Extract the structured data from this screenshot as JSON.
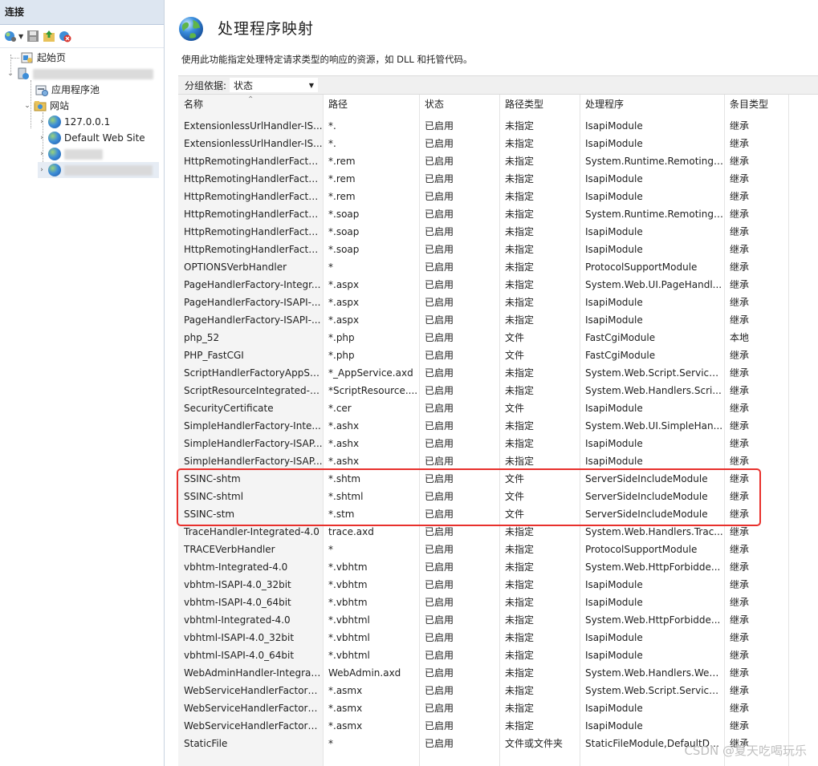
{
  "connections": {
    "title": "连接",
    "toolbar": [
      "connect-icon",
      "save-icon",
      "up-icon",
      "disconnect-icon"
    ],
    "tree": [
      {
        "label": "起始页",
        "icon": "start-page-icon"
      },
      {
        "label": "",
        "icon": "server-icon"
      },
      {
        "label": "应用程序池",
        "icon": "app-pool-icon"
      },
      {
        "label": "网站",
        "icon": "sites-folder-icon"
      },
      {
        "label": "127.0.0.1",
        "icon": "globe-icon"
      },
      {
        "label": "Default Web Site",
        "icon": "globe-icon"
      },
      {
        "label": "",
        "icon": "globe-icon"
      },
      {
        "label": "",
        "icon": "globe-icon"
      }
    ]
  },
  "page": {
    "title": "处理程序映射",
    "description": "使用此功能指定处理特定请求类型的响应的资源，如 DLL 和托管代码。",
    "groupby_label": "分组依据:",
    "groupby_value": "状态"
  },
  "table": {
    "columns": [
      "名称",
      "路径",
      "状态",
      "路径类型",
      "处理程序",
      "条目类型"
    ],
    "rows": [
      [
        "ExtensionlessUrlHandler-IS...",
        "*.",
        "已启用",
        "未指定",
        "IsapiModule",
        "继承"
      ],
      [
        "ExtensionlessUrlHandler-IS...",
        "*.",
        "已启用",
        "未指定",
        "IsapiModule",
        "继承"
      ],
      [
        "HttpRemotingHandlerFacto...",
        "*.rem",
        "已启用",
        "未指定",
        "System.Runtime.Remoting....",
        "继承"
      ],
      [
        "HttpRemotingHandlerFacto...",
        "*.rem",
        "已启用",
        "未指定",
        "IsapiModule",
        "继承"
      ],
      [
        "HttpRemotingHandlerFacto...",
        "*.rem",
        "已启用",
        "未指定",
        "IsapiModule",
        "继承"
      ],
      [
        "HttpRemotingHandlerFacto...",
        "*.soap",
        "已启用",
        "未指定",
        "System.Runtime.Remoting....",
        "继承"
      ],
      [
        "HttpRemotingHandlerFacto...",
        "*.soap",
        "已启用",
        "未指定",
        "IsapiModule",
        "继承"
      ],
      [
        "HttpRemotingHandlerFacto...",
        "*.soap",
        "已启用",
        "未指定",
        "IsapiModule",
        "继承"
      ],
      [
        "OPTIONSVerbHandler",
        "*",
        "已启用",
        "未指定",
        "ProtocolSupportModule",
        "继承"
      ],
      [
        "PageHandlerFactory-Integr...",
        "*.aspx",
        "已启用",
        "未指定",
        "System.Web.UI.PageHandl...",
        "继承"
      ],
      [
        "PageHandlerFactory-ISAPI-...",
        "*.aspx",
        "已启用",
        "未指定",
        "IsapiModule",
        "继承"
      ],
      [
        "PageHandlerFactory-ISAPI-...",
        "*.aspx",
        "已启用",
        "未指定",
        "IsapiModule",
        "继承"
      ],
      [
        "php_52",
        "*.php",
        "已启用",
        "文件",
        "FastCgiModule",
        "本地"
      ],
      [
        "PHP_FastCGI",
        "*.php",
        "已启用",
        "文件",
        "FastCgiModule",
        "继承"
      ],
      [
        "ScriptHandlerFactoryAppSe...",
        "*_AppService.axd",
        "已启用",
        "未指定",
        "System.Web.Script.Services....",
        "继承"
      ],
      [
        "ScriptResourceIntegrated-4.0",
        "*ScriptResource....",
        "已启用",
        "未指定",
        "System.Web.Handlers.Scri...",
        "继承"
      ],
      [
        "SecurityCertificate",
        "*.cer",
        "已启用",
        "文件",
        "IsapiModule",
        "继承"
      ],
      [
        "SimpleHandlerFactory-Inte...",
        "*.ashx",
        "已启用",
        "未指定",
        "System.Web.UI.SimpleHan...",
        "继承"
      ],
      [
        "SimpleHandlerFactory-ISAP...",
        "*.ashx",
        "已启用",
        "未指定",
        "IsapiModule",
        "继承"
      ],
      [
        "SimpleHandlerFactory-ISAP...",
        "*.ashx",
        "已启用",
        "未指定",
        "IsapiModule",
        "继承"
      ],
      [
        "SSINC-shtm",
        "*.shtm",
        "已启用",
        "文件",
        "ServerSideIncludeModule",
        "继承"
      ],
      [
        "SSINC-shtml",
        "*.shtml",
        "已启用",
        "文件",
        "ServerSideIncludeModule",
        "继承"
      ],
      [
        "SSINC-stm",
        "*.stm",
        "已启用",
        "文件",
        "ServerSideIncludeModule",
        "继承"
      ],
      [
        "TraceHandler-Integrated-4.0",
        "trace.axd",
        "已启用",
        "未指定",
        "System.Web.Handlers.Trac...",
        "继承"
      ],
      [
        "TRACEVerbHandler",
        "*",
        "已启用",
        "未指定",
        "ProtocolSupportModule",
        "继承"
      ],
      [
        "vbhtm-Integrated-4.0",
        "*.vbhtm",
        "已启用",
        "未指定",
        "System.Web.HttpForbidde...",
        "继承"
      ],
      [
        "vbhtm-ISAPI-4.0_32bit",
        "*.vbhtm",
        "已启用",
        "未指定",
        "IsapiModule",
        "继承"
      ],
      [
        "vbhtm-ISAPI-4.0_64bit",
        "*.vbhtm",
        "已启用",
        "未指定",
        "IsapiModule",
        "继承"
      ],
      [
        "vbhtml-Integrated-4.0",
        "*.vbhtml",
        "已启用",
        "未指定",
        "System.Web.HttpForbidde...",
        "继承"
      ],
      [
        "vbhtml-ISAPI-4.0_32bit",
        "*.vbhtml",
        "已启用",
        "未指定",
        "IsapiModule",
        "继承"
      ],
      [
        "vbhtml-ISAPI-4.0_64bit",
        "*.vbhtml",
        "已启用",
        "未指定",
        "IsapiModule",
        "继承"
      ],
      [
        "WebAdminHandler-Integrat...",
        "WebAdmin.axd",
        "已启用",
        "未指定",
        "System.Web.Handlers.Web...",
        "继承"
      ],
      [
        "WebServiceHandlerFactory-...",
        "*.asmx",
        "已启用",
        "未指定",
        "System.Web.Script.Services....",
        "继承"
      ],
      [
        "WebServiceHandlerFactory-...",
        "*.asmx",
        "已启用",
        "未指定",
        "IsapiModule",
        "继承"
      ],
      [
        "WebServiceHandlerFactory-...",
        "*.asmx",
        "已启用",
        "未指定",
        "IsapiModule",
        "继承"
      ],
      [
        "StaticFile",
        "*",
        "已启用",
        "文件或文件夹",
        "StaticFileModule,DefaultDo...",
        "继承"
      ]
    ]
  },
  "annotation": {
    "color": "#e8302c"
  },
  "watermark": "CSDN @夏天吃喝玩乐"
}
